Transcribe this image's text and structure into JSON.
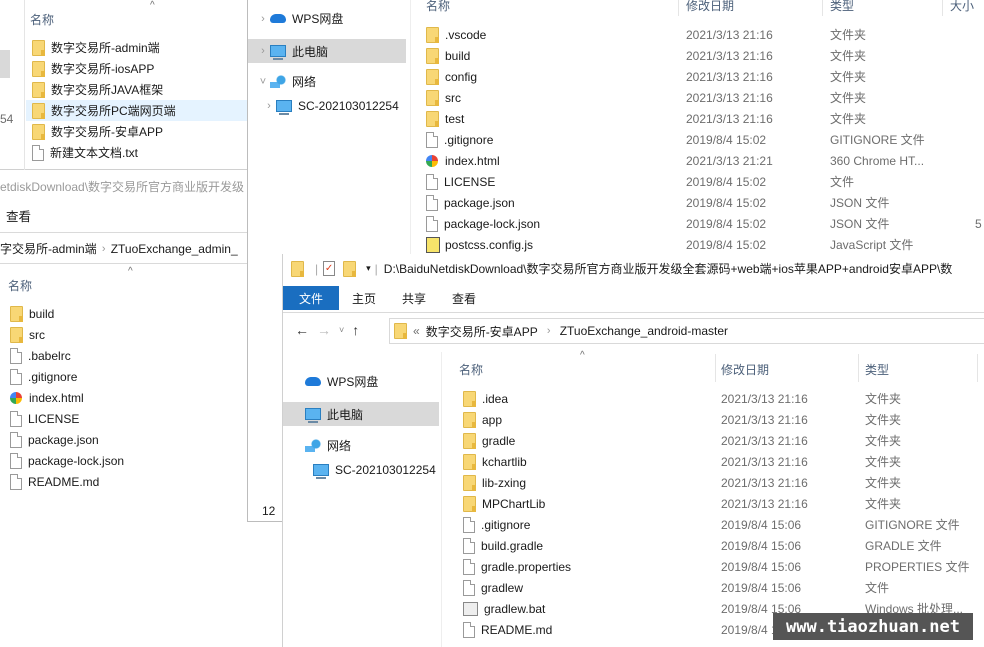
{
  "win_topleft": {
    "col_name": "名称",
    "items": [
      {
        "name": "数字交易所-admin端",
        "icon": "folder-icon"
      },
      {
        "name": "数字交易所-iosAPP",
        "icon": "folder-icon"
      },
      {
        "name": "数字交易所JAVA框架",
        "icon": "folder-icon"
      },
      {
        "name": "数字交易所PC端网页端",
        "icon": "folder-icon",
        "selected": true
      },
      {
        "name": "数字交易所-安卓APP",
        "icon": "folder-icon"
      },
      {
        "name": "新建文本文档.txt",
        "icon": "text-file-icon"
      }
    ],
    "side_fragment": "54"
  },
  "win_left": {
    "title_fragment": "etdiskDownload\\数字交易所官方商业版开发级",
    "ribbon_tab": "查看",
    "breadcrumb": [
      "字交易所-admin端",
      "ZTuoExchange_admin_"
    ],
    "col_name": "名称",
    "items": [
      {
        "name": "build",
        "icon": "folder-icon"
      },
      {
        "name": "src",
        "icon": "folder-icon"
      },
      {
        "name": ".babelrc",
        "icon": "file-icon"
      },
      {
        "name": ".gitignore",
        "icon": "file-icon"
      },
      {
        "name": "index.html",
        "icon": "chrome-icon"
      },
      {
        "name": "LICENSE",
        "icon": "file-icon"
      },
      {
        "name": "package.json",
        "icon": "file-icon"
      },
      {
        "name": "package-lock.json",
        "icon": "file-icon"
      },
      {
        "name": "README.md",
        "icon": "file-icon"
      }
    ]
  },
  "win_mid_nav": {
    "items": [
      {
        "label": "WPS网盘",
        "icon": "cloud-icon"
      },
      {
        "label": "此电脑",
        "icon": "computer-icon",
        "selected": true
      },
      {
        "label": "网络",
        "icon": "network-icon",
        "expanded": true
      },
      {
        "label": "SC-202103012254",
        "icon": "computer-icon"
      }
    ],
    "status_fragment": "12"
  },
  "win_top": {
    "columns": [
      "名称",
      "修改日期",
      "类型",
      "大小"
    ],
    "rows": [
      {
        "name": ".vscode",
        "date": "2021/3/13 21:16",
        "type": "文件夹",
        "size": "",
        "icon": "folder-icon"
      },
      {
        "name": "build",
        "date": "2021/3/13 21:16",
        "type": "文件夹",
        "size": "",
        "icon": "folder-icon"
      },
      {
        "name": "config",
        "date": "2021/3/13 21:16",
        "type": "文件夹",
        "size": "",
        "icon": "folder-icon"
      },
      {
        "name": "src",
        "date": "2021/3/13 21:16",
        "type": "文件夹",
        "size": "",
        "icon": "folder-icon"
      },
      {
        "name": "test",
        "date": "2021/3/13 21:16",
        "type": "文件夹",
        "size": "",
        "icon": "folder-icon"
      },
      {
        "name": ".gitignore",
        "date": "2019/8/4 15:02",
        "type": "GITIGNORE 文件",
        "size": "",
        "icon": "file-icon"
      },
      {
        "name": "index.html",
        "date": "2021/3/13 21:21",
        "type": "360 Chrome HT...",
        "size": "",
        "icon": "chrome-icon"
      },
      {
        "name": "LICENSE",
        "date": "2019/8/4 15:02",
        "type": "文件",
        "size": "",
        "icon": "file-icon"
      },
      {
        "name": "package.json",
        "date": "2019/8/4 15:02",
        "type": "JSON 文件",
        "size": "",
        "icon": "file-icon"
      },
      {
        "name": "package-lock.json",
        "date": "2019/8/4 15:02",
        "type": "JSON 文件",
        "size": "5",
        "icon": "file-icon"
      },
      {
        "name": "postcss.config.js",
        "date": "2019/8/4 15:02",
        "type": "JavaScript 文件",
        "size": "",
        "icon": "js-file-icon"
      }
    ]
  },
  "win_main": {
    "title_path": "D:\\BaiduNetdiskDownload\\数字交易所官方商业版开发级全套源码+web端+ios苹果APP+android安卓APP\\数",
    "ribbon_tabs": [
      "文件",
      "主页",
      "共享",
      "查看"
    ],
    "breadcrumb": {
      "overflow": "«",
      "parts": [
        "数字交易所-安卓APP",
        "ZTuoExchange_android-master"
      ]
    },
    "nav": [
      {
        "label": "WPS网盘",
        "icon": "cloud-icon"
      },
      {
        "label": "此电脑",
        "icon": "computer-icon",
        "selected": true
      },
      {
        "label": "网络",
        "icon": "network-icon"
      },
      {
        "label": "SC-202103012254",
        "icon": "computer-icon"
      }
    ],
    "columns": [
      "名称",
      "修改日期",
      "类型"
    ],
    "rows": [
      {
        "name": ".idea",
        "date": "2021/3/13 21:16",
        "type": "文件夹",
        "icon": "folder-icon"
      },
      {
        "name": "app",
        "date": "2021/3/13 21:16",
        "type": "文件夹",
        "icon": "folder-icon"
      },
      {
        "name": "gradle",
        "date": "2021/3/13 21:16",
        "type": "文件夹",
        "icon": "folder-icon"
      },
      {
        "name": "kchartlib",
        "date": "2021/3/13 21:16",
        "type": "文件夹",
        "icon": "folder-icon"
      },
      {
        "name": "lib-zxing",
        "date": "2021/3/13 21:16",
        "type": "文件夹",
        "icon": "folder-icon"
      },
      {
        "name": "MPChartLib",
        "date": "2021/3/13 21:16",
        "type": "文件夹",
        "icon": "folder-icon"
      },
      {
        "name": ".gitignore",
        "date": "2019/8/4 15:06",
        "type": "GITIGNORE 文件",
        "icon": "file-icon"
      },
      {
        "name": "build.gradle",
        "date": "2019/8/4 15:06",
        "type": "GRADLE 文件",
        "icon": "file-icon"
      },
      {
        "name": "gradle.properties",
        "date": "2019/8/4 15:06",
        "type": "PROPERTIES 文件",
        "icon": "file-icon"
      },
      {
        "name": "gradlew",
        "date": "2019/8/4 15:06",
        "type": "文件",
        "icon": "file-icon"
      },
      {
        "name": "gradlew.bat",
        "date": "2019/8/4 15:06",
        "type": "Windows 批处理...",
        "icon": "batch-file-icon"
      },
      {
        "name": "README.md",
        "date": "2019/8/4 15:06",
        "type": "",
        "icon": "file-icon"
      }
    ]
  },
  "watermark": "www.tiaozhuan.net"
}
